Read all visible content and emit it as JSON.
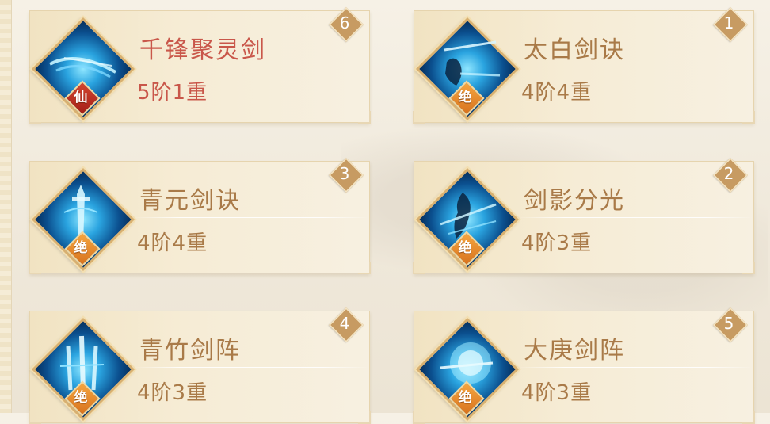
{
  "skills": [
    {
      "name": "千锋聚灵剑",
      "level": "5阶1重",
      "rank": "6",
      "grade": "仙",
      "grade_type": "xian"
    },
    {
      "name": "太白剑诀",
      "level": "4阶4重",
      "rank": "1",
      "grade": "绝",
      "grade_type": "jue"
    },
    {
      "name": "青元剑诀",
      "level": "4阶4重",
      "rank": "3",
      "grade": "绝",
      "grade_type": "jue"
    },
    {
      "name": "剑影分光",
      "level": "4阶3重",
      "rank": "2",
      "grade": "绝",
      "grade_type": "jue"
    },
    {
      "name": "青竹剑阵",
      "level": "4阶3重",
      "rank": "4",
      "grade": "绝",
      "grade_type": "jue"
    },
    {
      "name": "大庚剑阵",
      "level": "4阶3重",
      "rank": "5",
      "grade": "绝",
      "grade_type": "jue"
    }
  ],
  "icons": [
    "sword-aura-icon",
    "swordsman-silhouette-icon",
    "blade-icon",
    "sword-shadow-icon",
    "bamboo-swords-icon",
    "sword-orb-icon"
  ],
  "colors": {
    "xian": "#c9574a",
    "jue": "#a97a48",
    "badge": "#c79b62"
  }
}
